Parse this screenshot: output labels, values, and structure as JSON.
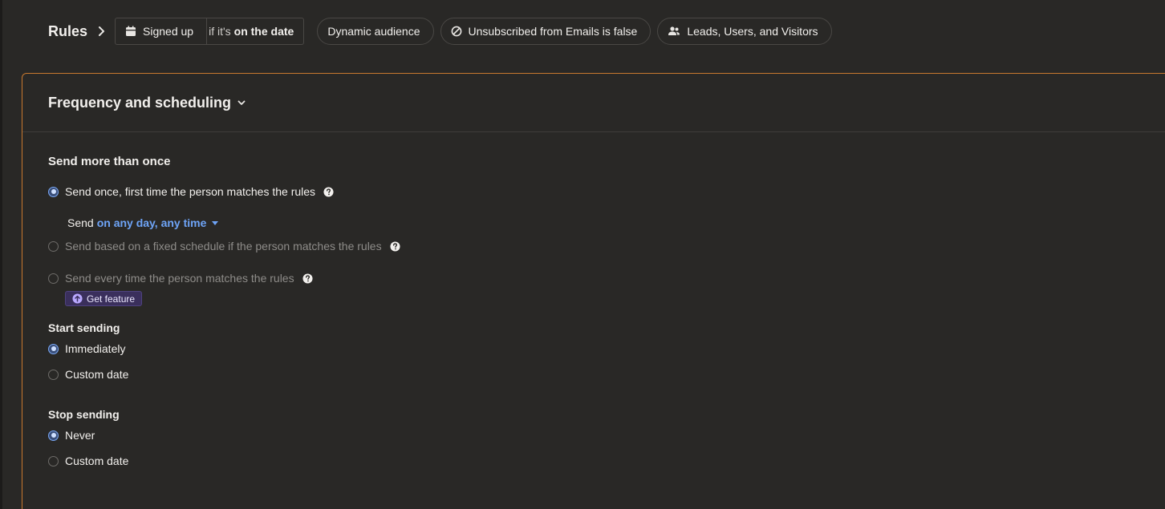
{
  "rules_bar": {
    "title": "Rules",
    "trigger_label": "Signed up",
    "condition_prefix": "if it's",
    "condition_value": "on the date",
    "chips": [
      {
        "label": "Dynamic audience",
        "icon": ""
      },
      {
        "label": "Unsubscribed from Emails is false",
        "icon": "ban-icon"
      },
      {
        "label": "Leads, Users, and Visitors",
        "icon": "people-icon"
      }
    ]
  },
  "card": {
    "title": "Frequency and scheduling"
  },
  "frequency": {
    "section_title": "Send more than once",
    "options": [
      {
        "label": "Send once, first time the person matches the rules",
        "selected": true,
        "enabled": true
      },
      {
        "label": "Send based on a fixed schedule if the person matches the rules",
        "selected": false,
        "enabled": false
      },
      {
        "label": "Send every time the person matches the rules",
        "selected": false,
        "enabled": false
      }
    ],
    "send_prefix": "Send",
    "send_timing": "on any day, any time",
    "get_feature_label": "Get feature"
  },
  "start_sending": {
    "title": "Start sending",
    "options": [
      {
        "label": "Immediately",
        "selected": true
      },
      {
        "label": "Custom date",
        "selected": false
      }
    ]
  },
  "stop_sending": {
    "title": "Stop sending",
    "options": [
      {
        "label": "Never",
        "selected": true
      },
      {
        "label": "Custom date",
        "selected": false
      }
    ]
  },
  "colors": {
    "background": "#292826",
    "card_border": "#c8792f",
    "link": "#6ea4f7",
    "radio_selected": "#7aa8f5",
    "feature_badge": "#3a2f5c"
  }
}
